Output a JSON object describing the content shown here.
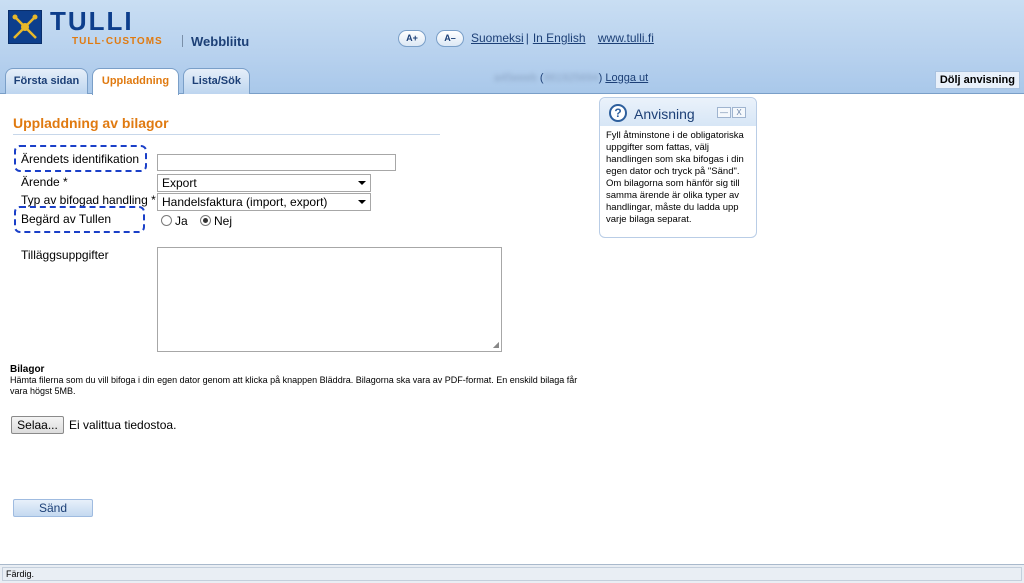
{
  "header": {
    "brand": "TULLI",
    "brand_sub": "TULL·CUSTOMS",
    "app_name": "Webbliitu",
    "font_increase": "A+",
    "font_decrease": "A–",
    "links": {
      "finnish": "Suomeksi",
      "english": "In English",
      "site": "www.tulli.fi"
    }
  },
  "tabs": [
    {
      "label": "Första sidan"
    },
    {
      "label": "Uppladdning"
    },
    {
      "label": "Lista/Sök"
    }
  ],
  "user": {
    "name_blurred": "a45eeeb",
    "id_blurred": "881925694",
    "logout": "Logga ut"
  },
  "hide_help_label": "Dölj anvisning",
  "form": {
    "title": "Uppladdning av bilagor",
    "fields": {
      "case_id_label": "Ärendets identifikation",
      "case_id_value": "",
      "case_label": "Ärende *",
      "case_value": "Export",
      "doc_type_label": "Typ av bifogad handling *",
      "doc_type_value": "Handelsfaktura (import, export)",
      "requested_label": "Begärd av Tullen",
      "requested_yes": "Ja",
      "requested_no": "Nej",
      "requested_selected": "Nej",
      "extra_label": "Tilläggsuppgifter",
      "extra_value": ""
    },
    "attachments": {
      "title": "Bilagor",
      "text": "Hämta filerna som du vill bifoga i din egen dator genom att klicka på knappen Bläddra. Bilagorna ska vara av PDF-format. En enskild bilaga får vara högst 5MB.",
      "browse_label": "Selaa...",
      "no_file": "Ei valittua tiedostoa."
    },
    "send_label": "Sänd"
  },
  "help": {
    "title": "Anvisning",
    "text": "Fyll åtminstone i de obligatoriska uppgifter som fattas, välj handlingen som ska bifogas i din egen dator och tryck på \"Sänd\". Om bilagorna som hänför sig till samma ärende är olika typer av handlingar, måste du ladda upp varje bilaga separat."
  },
  "status_bar": {
    "text": "Färdig."
  },
  "colors": {
    "accent_orange": "#e07a10",
    "brand_blue": "#0d3e8c",
    "annotation_dash": "#1a3fc8"
  }
}
